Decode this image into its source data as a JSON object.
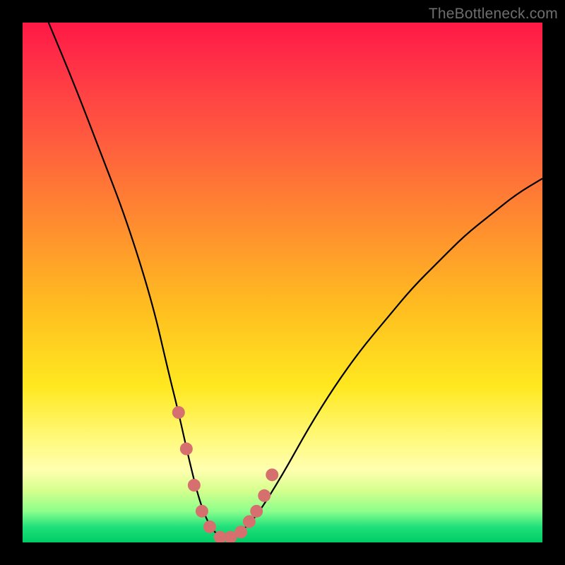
{
  "watermark": "TheBottleneck.com",
  "chart_data": {
    "type": "line",
    "title": "",
    "xlabel": "",
    "ylabel": "",
    "xlim": [
      0,
      100
    ],
    "ylim": [
      0,
      100
    ],
    "series": [
      {
        "name": "bottleneck-curve",
        "x": [
          5,
          10,
          15,
          20,
          25,
          28,
          30,
          32,
          34,
          36,
          38,
          40,
          42,
          45,
          50,
          55,
          60,
          65,
          70,
          75,
          80,
          85,
          90,
          95,
          100
        ],
        "values": [
          100,
          88,
          75,
          62,
          46,
          33,
          25,
          16,
          8,
          3,
          1,
          1,
          2,
          5,
          13,
          22,
          30,
          37,
          43,
          49,
          54,
          59,
          63,
          67,
          70
        ]
      }
    ],
    "markers": {
      "name": "highlight-dots",
      "color": "#d6706f",
      "x": [
        30.0,
        31.5,
        33.0,
        34.5,
        36.0,
        38.0,
        40.0,
        42.0,
        43.6,
        45.0,
        46.5,
        48.0
      ],
      "values": [
        25,
        18,
        11,
        6,
        3,
        1,
        1,
        2,
        4,
        6,
        9,
        13
      ]
    },
    "background_gradient": {
      "direction": "vertical",
      "stops": [
        {
          "offset": 0,
          "color": "#ff1846"
        },
        {
          "offset": 22,
          "color": "#ff5a3f"
        },
        {
          "offset": 55,
          "color": "#ffbe20"
        },
        {
          "offset": 80,
          "color": "#fff97a"
        },
        {
          "offset": 94,
          "color": "#8cff8c"
        },
        {
          "offset": 100,
          "color": "#00cc66"
        }
      ]
    }
  }
}
